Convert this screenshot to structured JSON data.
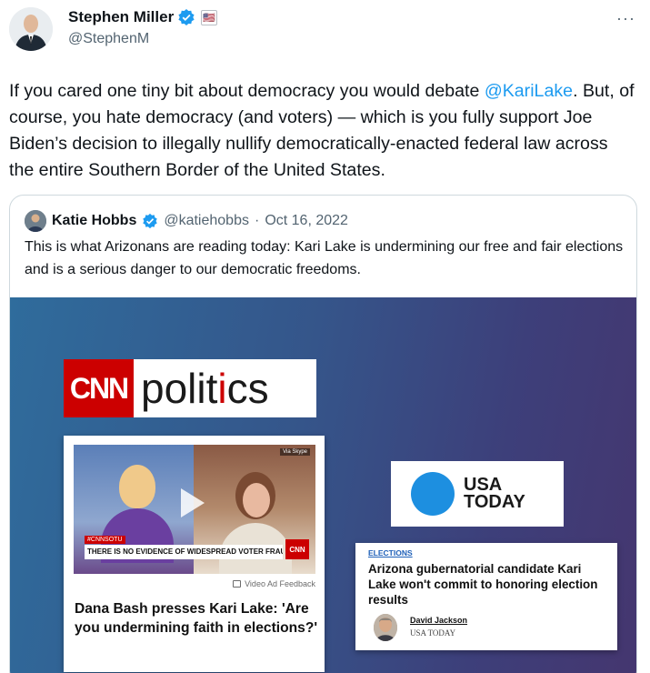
{
  "tweet": {
    "author_name": "Stephen Miller",
    "author_flag": "🇺🇸",
    "author_handle": "@StephenM",
    "more_label": "···",
    "text_before": "If you cared one tiny bit about democracy you would debate ",
    "mention": "@KariLake",
    "text_after": ". But, of course, you hate democracy (and voters)  — which is you fully support Joe Biden’s decision to illegally nullify democratically-enacted federal law across the entire Southern Border of the United States."
  },
  "quote": {
    "author_name": "Katie Hobbs",
    "author_handle": "@katiehobbs",
    "separator": "·",
    "date": "Oct 16, 2022",
    "text": "This is what Arizonans are reading today: Kari Lake is undermining our free and fair elections and is a serious danger to our democratic freedoms."
  },
  "media": {
    "cnn": {
      "logo_mark": "CNN",
      "logo_word_a": "polit",
      "logo_word_i": "i",
      "logo_word_b": "cs",
      "chyron_tag": "#CNNSOTU",
      "chyron_text": "THERE IS NO EVIDENCE OF WIDESPREAD VOTER FRAUD IN UNITED STATES",
      "bug": "CNN",
      "video_time": "Via Skype",
      "feedback": "Video Ad Feedback",
      "headline": "Dana Bash presses Kari Lake: 'Are you undermining faith in elections?'"
    },
    "usa_today": {
      "logo_line1": "USA",
      "logo_line2": "TODAY",
      "section": "ELECTIONS",
      "headline": "Arizona gubernatorial candidate Kari Lake won't commit to honoring election results",
      "byline_name": "David Jackson",
      "byline_pub": "USA TODAY"
    }
  },
  "colors": {
    "verified": "#1d9bf0",
    "mention": "#1d9bf0",
    "cnn_red": "#cc0000",
    "usa_blue": "#1d8fe0"
  },
  "icons": [
    "verified-badge-icon",
    "flag-icon",
    "more-options-icon",
    "play-icon",
    "feedback-icon"
  ]
}
